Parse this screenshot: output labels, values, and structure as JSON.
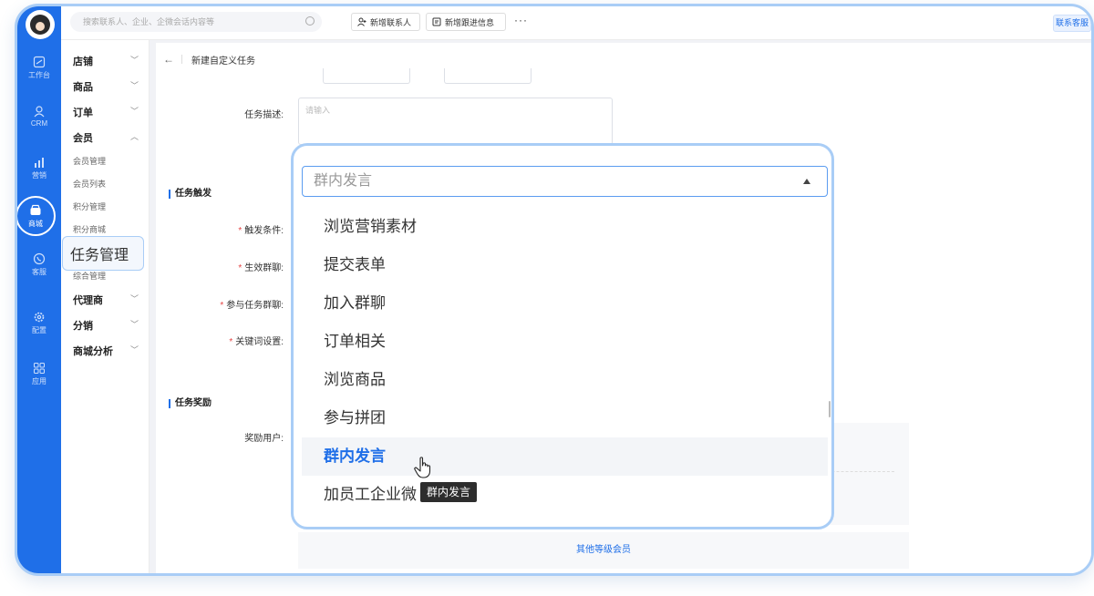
{
  "colors": {
    "brand": "#1f6fe8",
    "highlight_border": "#a9cdf6",
    "required": "#e54545"
  },
  "rail": {
    "items": [
      {
        "label": "工作台",
        "icon": "workbench-icon"
      },
      {
        "label": "CRM",
        "icon": "user-icon"
      },
      {
        "label": "营销",
        "icon": "chart-bar-icon"
      },
      {
        "label": "商城",
        "icon": "store-icon",
        "active": true
      },
      {
        "label": "客服",
        "icon": "phone-icon"
      },
      {
        "label": "配置",
        "icon": "gear-icon"
      },
      {
        "label": "应用",
        "icon": "apps-grid-icon"
      }
    ]
  },
  "menu": {
    "shop": "店铺",
    "goods": "商品",
    "order": "订单",
    "member": "会员",
    "member_manage": "会员管理",
    "member_list": "会员列表",
    "points_manage": "积分管理",
    "points_mall": "积分商城",
    "task_manage": "任务管理",
    "general_manage": "综合管理",
    "agent": "代理商",
    "distribution": "分销",
    "mall_analysis": "商城分析"
  },
  "topbar": {
    "search_placeholder": "搜索联系人、企业、企微会话内容等",
    "add_contact": "新增联系人",
    "add_followup": "新增跟进信息",
    "more": "···",
    "contact_service": "联系客服"
  },
  "page": {
    "title": "新建自定义任务",
    "task_desc_label": "任务描述:",
    "task_desc_placeholder": "请输入",
    "trigger_section": "任务触发",
    "trigger_condition": "触发条件:",
    "effective_group": "生效群聊:",
    "join_group": "参与任务群聊:",
    "keyword_setting": "关键词设置:",
    "reward_section": "任务奖励",
    "reward_users": "奖励用户:",
    "other_members": "其他等级会员"
  },
  "dropdown": {
    "selected_value": "群内发言",
    "options": [
      "浏览营销素材",
      "提交表单",
      "加入群聊",
      "订单相关",
      "浏览商品",
      "参与拼团",
      "群内发言",
      "加员工企业微"
    ],
    "highlighted_index": 6,
    "tooltip": "群内发言"
  }
}
